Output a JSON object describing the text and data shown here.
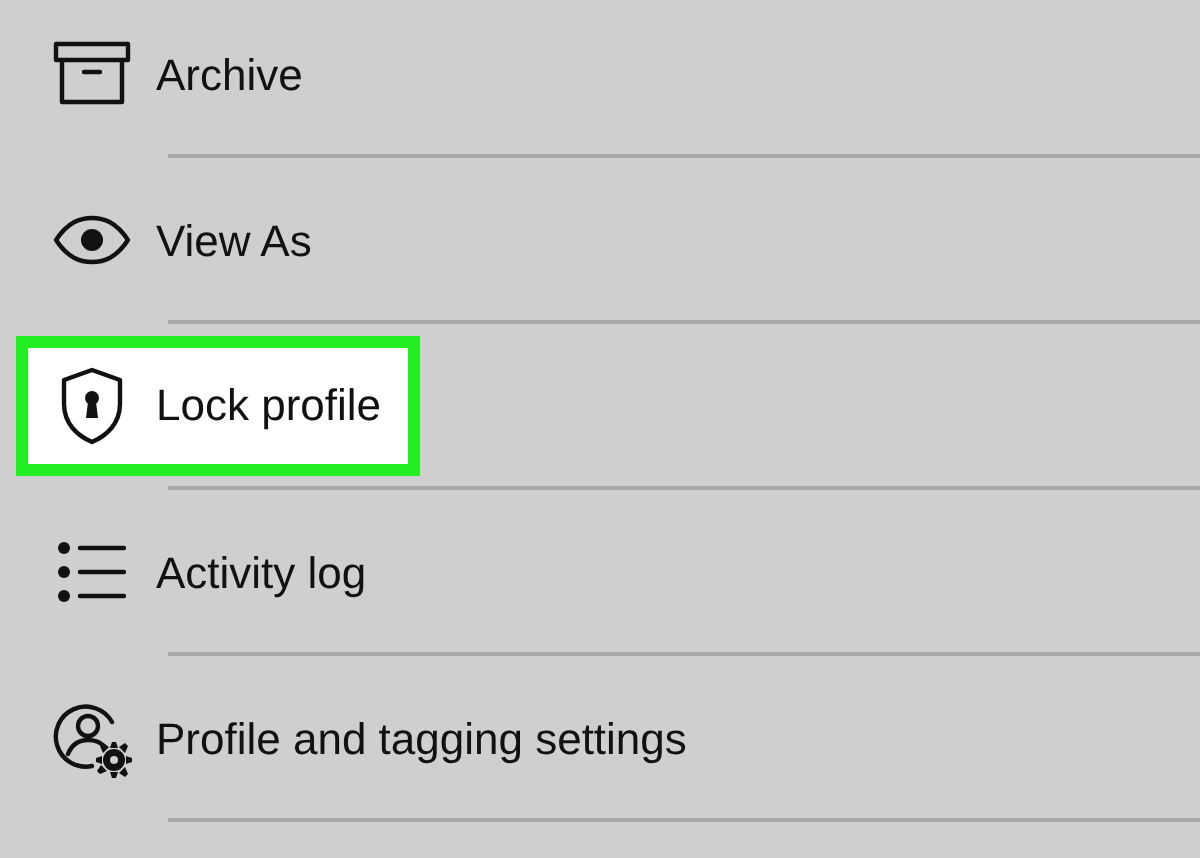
{
  "menu": {
    "items": [
      {
        "kind": "archive",
        "label": "Archive",
        "highlighted": false
      },
      {
        "kind": "view",
        "label": "View As",
        "highlighted": false
      },
      {
        "kind": "lock",
        "label": "Lock profile",
        "highlighted": true
      },
      {
        "kind": "activity",
        "label": "Activity log",
        "highlighted": false
      },
      {
        "kind": "profile-settings",
        "label": "Profile and tagging settings",
        "highlighted": false
      }
    ]
  }
}
